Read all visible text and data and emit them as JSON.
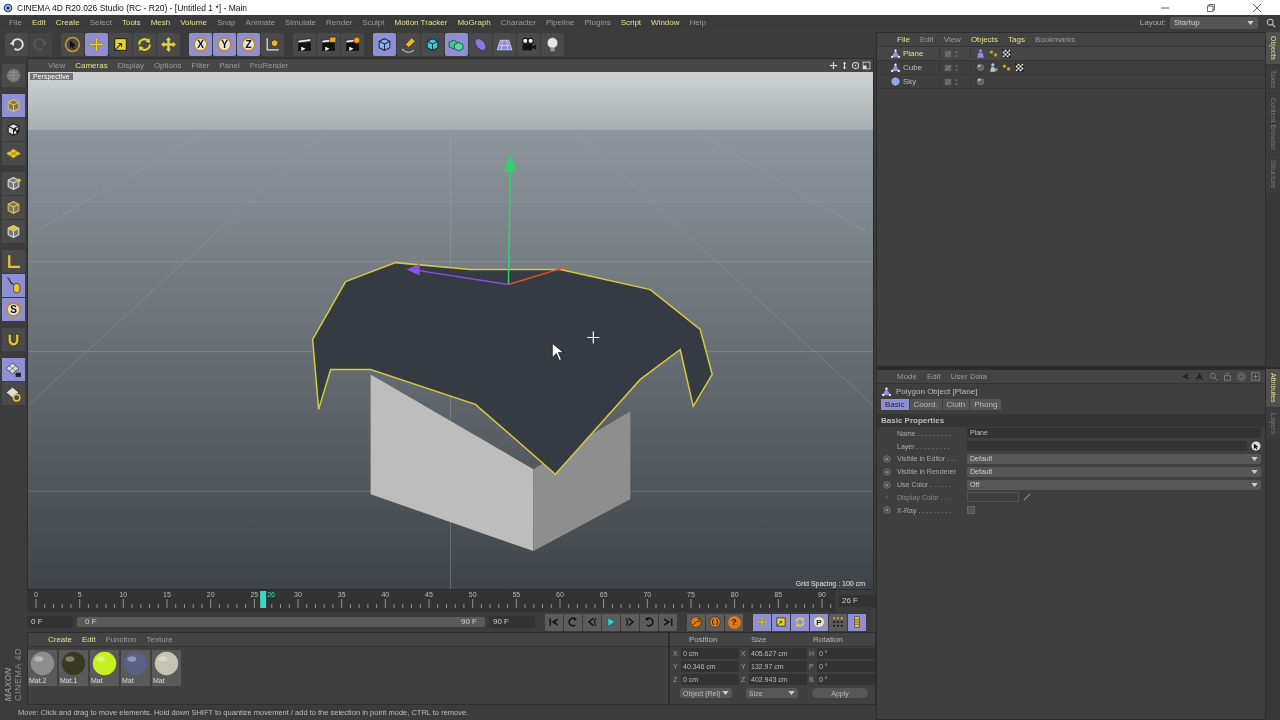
{
  "window": {
    "title": "CINEMA 4D R20.026 Studio (RC - R20) - [Untitled 1 *] - Main"
  },
  "menu_bar": [
    {
      "label": "File",
      "highlighted": false
    },
    {
      "label": "Edit",
      "highlighted": true
    },
    {
      "label": "Create",
      "highlighted": true
    },
    {
      "label": "Select",
      "highlighted": false
    },
    {
      "label": "Tools",
      "highlighted": true
    },
    {
      "label": "Mesh",
      "highlighted": true
    },
    {
      "label": "Volume",
      "highlighted": true
    },
    {
      "label": "Snap",
      "highlighted": false
    },
    {
      "label": "Animate",
      "highlighted": false
    },
    {
      "label": "Simulate",
      "highlighted": false
    },
    {
      "label": "Render",
      "highlighted": false
    },
    {
      "label": "Sculpt",
      "highlighted": false
    },
    {
      "label": "Motion Tracker",
      "highlighted": true
    },
    {
      "label": "MoGraph",
      "highlighted": true
    },
    {
      "label": "Character",
      "highlighted": false
    },
    {
      "label": "Pipeline",
      "highlighted": false
    },
    {
      "label": "Plugins",
      "highlighted": false
    },
    {
      "label": "Script",
      "highlighted": true
    },
    {
      "label": "Window",
      "highlighted": true
    },
    {
      "label": "Help",
      "highlighted": false
    }
  ],
  "layout": {
    "label": "Layout:",
    "value": "Startup"
  },
  "toolbar": [
    {
      "kind": "undo",
      "selected": false,
      "disabled": false
    },
    {
      "kind": "redo",
      "selected": false,
      "disabled": true
    },
    {
      "kind": "select",
      "selected": false,
      "disabled": false
    },
    {
      "kind": "move",
      "selected": true,
      "disabled": false
    },
    {
      "kind": "scale",
      "selected": false,
      "disabled": false
    },
    {
      "kind": "rotate",
      "selected": false,
      "disabled": false
    },
    {
      "kind": "move-recent",
      "selected": false,
      "disabled": false
    },
    {
      "kind": "letter",
      "label": "X",
      "selected": true,
      "disabled": false
    },
    {
      "kind": "letter",
      "label": "Y",
      "selected": true,
      "disabled": false
    },
    {
      "kind": "letter",
      "label": "Z",
      "selected": true,
      "disabled": false
    },
    {
      "kind": "coords",
      "selected": false,
      "disabled": false
    },
    {
      "kind": "render-view",
      "selected": false,
      "disabled": false
    },
    {
      "kind": "render-picture",
      "selected": false,
      "disabled": false
    },
    {
      "kind": "render-settings",
      "selected": false,
      "disabled": false
    },
    {
      "kind": "cube",
      "selected": true,
      "disabled": false
    },
    {
      "kind": "pen",
      "selected": false,
      "disabled": false
    },
    {
      "kind": "subdivision",
      "selected": false,
      "disabled": false
    },
    {
      "kind": "cloner",
      "selected": true,
      "disabled": false
    },
    {
      "kind": "deformer",
      "selected": false,
      "disabled": false
    },
    {
      "kind": "floor",
      "selected": false,
      "disabled": false
    },
    {
      "kind": "camera",
      "selected": false,
      "disabled": false
    },
    {
      "kind": "light",
      "selected": false,
      "disabled": false
    }
  ],
  "left_toolbar": [
    {
      "kind": "make-editable",
      "selected": false
    },
    {
      "kind": "model",
      "selected": true
    },
    {
      "kind": "texture",
      "selected": false
    },
    {
      "kind": "workplane",
      "selected": false
    },
    {
      "kind": "points",
      "selected": false
    },
    {
      "kind": "edges",
      "selected": false
    },
    {
      "kind": "polygons",
      "selected": false
    },
    {
      "kind": "axis-mode",
      "selected": false
    },
    {
      "kind": "tweak",
      "selected": true
    },
    {
      "kind": "letter",
      "label": "S",
      "selected": true
    },
    {
      "kind": "snap",
      "selected": false
    },
    {
      "kind": "lock-workplane",
      "selected": true
    },
    {
      "kind": "planar",
      "selected": false
    }
  ],
  "viewport": {
    "menu": [
      {
        "label": "View",
        "highlighted": false
      },
      {
        "label": "Cameras",
        "highlighted": true
      },
      {
        "label": "Display",
        "highlighted": false
      },
      {
        "label": "Options",
        "highlighted": false
      },
      {
        "label": "Filter",
        "highlighted": false
      },
      {
        "label": "Panel",
        "highlighted": false
      },
      {
        "label": "ProRender",
        "highlighted": false
      }
    ],
    "camera": "Perspective",
    "grid_spacing": "Grid Spacing : 100 cm"
  },
  "timeline": {
    "ticks": [
      "0",
      "5",
      "10",
      "15",
      "20",
      "25",
      "30",
      "35",
      "40",
      "45",
      "50",
      "55",
      "60",
      "65",
      "70",
      "75",
      "80",
      "85",
      "90"
    ],
    "playhead": {
      "label": "26",
      "level": 0.289
    },
    "current_frame": "26 F",
    "start": "0 F",
    "range_start": "0 F",
    "range_end": "90 F",
    "end": "90 F",
    "transport": [
      {
        "kind": "first"
      },
      {
        "kind": "loop-prev"
      },
      {
        "kind": "prev"
      },
      {
        "kind": "play"
      },
      {
        "kind": "next"
      },
      {
        "kind": "loop-next"
      },
      {
        "kind": "last"
      }
    ],
    "record": [
      {
        "kind": "record-key"
      },
      {
        "kind": "autokey"
      },
      {
        "kind": "letter",
        "label": "?"
      }
    ],
    "keys": [
      {
        "kind": "move",
        "selected": true
      },
      {
        "kind": "scale",
        "selected": true
      },
      {
        "kind": "rotate",
        "selected": true
      },
      {
        "kind": "letter",
        "label": "P",
        "selected": true
      },
      {
        "kind": "dots",
        "selected": false
      },
      {
        "kind": "timeline",
        "selected": true
      }
    ]
  },
  "materials": {
    "menu": [
      {
        "label": "Create",
        "highlighted": true
      },
      {
        "label": "Edit",
        "highlighted": true
      },
      {
        "label": "Function",
        "highlighted": false
      },
      {
        "label": "Texture",
        "highlighted": false
      }
    ],
    "items": [
      {
        "name": "Mat.2",
        "color": "#8e8e8e"
      },
      {
        "name": "Mat.1",
        "color": "#3a3a20"
      },
      {
        "name": "Mat",
        "color": "#c8f020"
      },
      {
        "name": "Mat",
        "color": "#5a6088"
      },
      {
        "name": "Mat",
        "color": "#c4c4b2"
      }
    ]
  },
  "brand": {
    "company": "MAXON",
    "product": "CINEMA 4D"
  },
  "coordinates": {
    "headers": [
      "Position",
      "Size",
      "Rotation"
    ],
    "rows": [
      {
        "axis": "X",
        "position": "0 cm",
        "size_axis": "X",
        "size": "405.627 cm",
        "rotation_axis": "H",
        "rotation": "0 °"
      },
      {
        "axis": "Y",
        "position": "40.346 cm",
        "size_axis": "Y",
        "size": "132.97 cm",
        "rotation_axis": "P",
        "rotation": "0 °"
      },
      {
        "axis": "Z",
        "position": "0 cm",
        "size_axis": "Z",
        "size": "402.943 cm",
        "rotation_axis": "B",
        "rotation": "0 °"
      }
    ],
    "mode": "Object (Rel)",
    "size_mode": "Size",
    "apply": "Apply"
  },
  "status_bar": "Move: Click and drag to move elements. Hold down SHIFT to quantize movement / add to the selection in point mode, CTRL to remove.",
  "object_manager": {
    "menu": [
      {
        "label": "File",
        "highlighted": true
      },
      {
        "label": "Edit",
        "highlighted": false
      },
      {
        "label": "View",
        "highlighted": false
      },
      {
        "label": "Objects",
        "highlighted": true
      },
      {
        "label": "Tags",
        "highlighted": true
      },
      {
        "label": "Bookmarks",
        "highlighted": false
      }
    ],
    "objects": [
      {
        "name": "Plane",
        "kind": "polygon",
        "selected": true,
        "tags": [
          {
            "kind": "cloth"
          },
          {
            "kind": "phong"
          },
          {
            "kind": "uvw"
          }
        ]
      },
      {
        "name": "Cube",
        "kind": "polygon",
        "selected": false,
        "tags": [
          {
            "kind": "material"
          },
          {
            "kind": "collider"
          },
          {
            "kind": "phong"
          },
          {
            "kind": "uvw"
          }
        ]
      },
      {
        "name": "Sky",
        "kind": "sky",
        "selected": false,
        "tags": [
          {
            "kind": "material"
          }
        ]
      }
    ],
    "side_tabs": [
      {
        "label": "Objects",
        "selected": true
      },
      {
        "label": "Takes",
        "selected": false
      },
      {
        "label": "Content Browser",
        "selected": false
      },
      {
        "label": "Structure",
        "selected": false
      }
    ]
  },
  "attributes": {
    "menu": [
      {
        "label": "Mode",
        "highlighted": false
      },
      {
        "label": "Edit",
        "highlighted": false
      },
      {
        "label": "User Data",
        "highlighted": false
      }
    ],
    "title": "Polygon Object [Plane]",
    "tabs": [
      {
        "label": "Basic",
        "selected": true
      },
      {
        "label": "Coord.",
        "selected": false
      },
      {
        "label": "Cloth",
        "selected": false
      },
      {
        "label": "Phong",
        "selected": false
      }
    ],
    "section": "Basic Properties",
    "fields": [
      {
        "kind": "text",
        "label": "Name . . . . . . . . .",
        "value": "Plane",
        "disabled": false
      },
      {
        "kind": "link",
        "label": "Layer . . . . . . . . .",
        "disabled": false
      },
      {
        "kind": "select",
        "label": "Visible in Editor . . .",
        "value": "Default",
        "disabled": false
      },
      {
        "kind": "select",
        "label": "Visible in Renderer",
        "value": "Default",
        "disabled": false
      },
      {
        "kind": "select",
        "label": "Use Color . . . . . .",
        "value": "Off",
        "disabled": false
      },
      {
        "kind": "color",
        "label": "Display Color . . .",
        "disabled": true
      },
      {
        "kind": "checkbox",
        "label": "X-Ray . . . . . . . . .",
        "checked": false,
        "disabled": false
      }
    ],
    "side_tabs": [
      {
        "label": "Attributes",
        "selected": true
      },
      {
        "label": "Layers",
        "selected": false
      }
    ]
  }
}
